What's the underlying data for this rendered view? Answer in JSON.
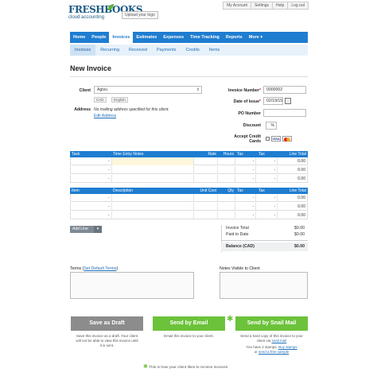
{
  "top_links": [
    "My Account",
    "Settings",
    "Help",
    "Log out"
  ],
  "brand": {
    "name": "FRESHBOOKS",
    "tagline": "cloud accounting",
    "upload_logo": "Upload your logo"
  },
  "main_nav": [
    {
      "label": "Home"
    },
    {
      "label": "People"
    },
    {
      "label": "Invoices"
    },
    {
      "label": "Estimates"
    },
    {
      "label": "Expenses"
    },
    {
      "label": "Time Tracking"
    },
    {
      "label": "Reports"
    },
    {
      "label": "More ▾"
    }
  ],
  "sub_nav": [
    {
      "label": "Invoices"
    },
    {
      "label": "Recurring"
    },
    {
      "label": "Received"
    },
    {
      "label": "Payments"
    },
    {
      "label": "Credits"
    },
    {
      "label": "Items"
    }
  ],
  "page_title": "New Invoice",
  "client": {
    "label": "Client",
    "value": "Agivu",
    "currency": "CAD",
    "language": "English",
    "address_label": "Address",
    "address_text": "No mailing address specified for this client.",
    "edit_address": "Edit Address"
  },
  "details": {
    "invoice_number_label": "Invoice Number",
    "invoice_number": "0000002",
    "date_label": "Date of Issue",
    "date": "02/19/15",
    "po_label": "PO Number",
    "po_value": "",
    "discount_label": "Discount",
    "discount_value": "%",
    "accept_label_1": "Accept Credit",
    "accept_label_2": "Cards",
    "visa": "VISA"
  },
  "task_table": {
    "headers": [
      "Task",
      "Time Entry Notes",
      "Rate",
      "Hours",
      "Tax",
      "Tax",
      "Line Total"
    ],
    "rows": [
      [
        "-",
        "",
        "",
        "",
        "-",
        "-",
        "0.00"
      ],
      [
        "-",
        "",
        "",
        "",
        "-",
        "-",
        "0.00"
      ],
      [
        "-",
        "",
        "",
        "",
        "-",
        "-",
        "0.00"
      ]
    ]
  },
  "item_table": {
    "headers": [
      "Item",
      "Description",
      "Unit Cost",
      "Qty",
      "Tax",
      "Tax",
      "Line Total"
    ],
    "rows": [
      [
        "-",
        "",
        "",
        "",
        "-",
        "-",
        "0.00"
      ],
      [
        "-",
        "",
        "",
        "",
        "-",
        "-",
        "0.00"
      ],
      [
        "-",
        "",
        "",
        "",
        "-",
        "-",
        "0.00"
      ]
    ]
  },
  "add_line": "Add Line",
  "totals": {
    "invoice_total_label": "Invoice Total",
    "invoice_total": "$0.00",
    "paid_label": "Paid to Date",
    "paid": "$0.00",
    "balance_label": "Balance (CAD)",
    "balance": "$0.00"
  },
  "terms": {
    "label": "Terms (",
    "link": "Set Default Terms",
    "close": ")"
  },
  "notes_label": "Notes Visible to Client",
  "send": {
    "draft": "Save as Draft",
    "draft_desc_1": "Save this invoice as a draft. Your client",
    "draft_desc_2": "will not be able to view this invoice until",
    "draft_desc_3": "it is sent.",
    "email": "Send by Email",
    "email_desc": "Email this invoice to your client.",
    "mail": "Send by Snail Mail",
    "mail_desc_1": "Send a hard copy of this invoice to your",
    "mail_desc_2": "client via",
    "mail_desc_link": "snail mail",
    "stamps_text": "You have 2 stamps.",
    "buy_stamps": "Buy stamps",
    "or_text": "or",
    "free_sample": "send a free sample",
    "star": "✱"
  },
  "footnote": "This is how your client likes to receive invoices."
}
